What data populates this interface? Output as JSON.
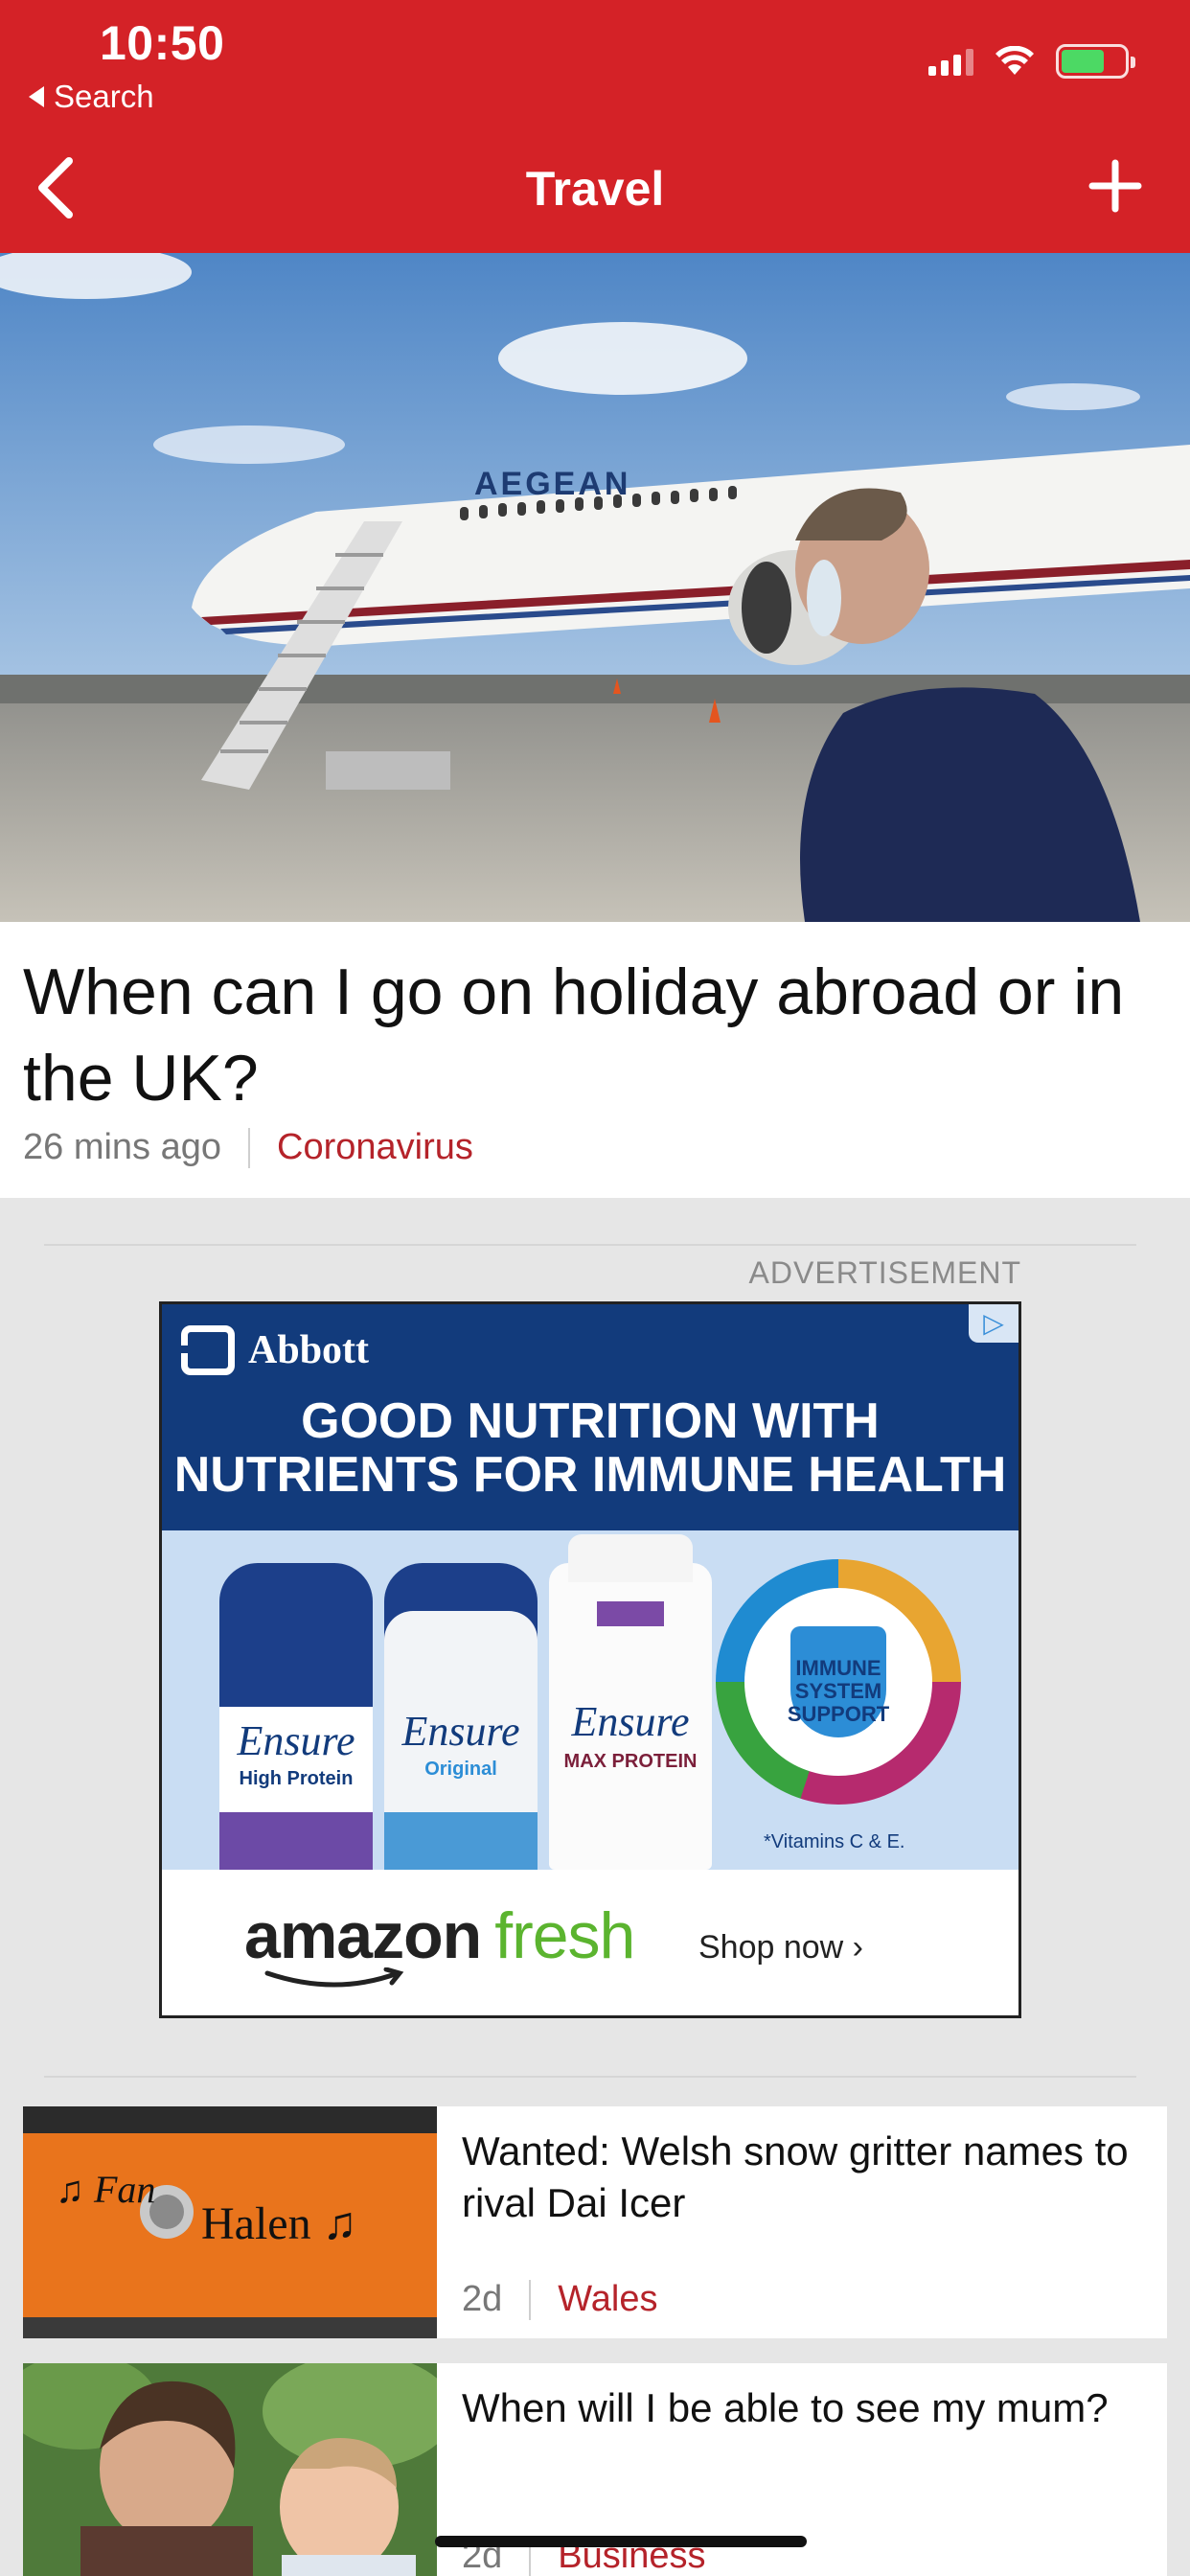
{
  "status_bar": {
    "time": "10:50",
    "back_app": "Search"
  },
  "nav": {
    "title": "Travel"
  },
  "lead_story": {
    "headline": "When can I go on holiday abroad or in the UK?",
    "time": "26 mins ago",
    "category": "Coronavirus",
    "image_caption_text": "AEGEAN"
  },
  "advertisement": {
    "label": "ADVERTISEMENT",
    "brand": "Abbott",
    "headline_line1": "GOOD NUTRITION WITH",
    "headline_line2": "NUTRIENTS FOR IMMUNE HEALTH",
    "products": [
      {
        "name": "Ensure",
        "subtitle": "High Protein"
      },
      {
        "name": "Ensure",
        "subtitle": "Original"
      },
      {
        "name": "Ensure",
        "subtitle": "MAX PROTEIN"
      }
    ],
    "badge_text": "IMMUNE SYSTEM SUPPORT",
    "vitamins_note": "*Vitamins C & E.",
    "retailer_part1": "amazon",
    "retailer_part2": "fresh",
    "cta": "Shop now ›"
  },
  "stories": [
    {
      "headline": "Wanted: Welsh snow gritter names to rival Dai Icer",
      "time": "2d",
      "category": "Wales",
      "thumb_text": "Fan Halen"
    },
    {
      "headline": "When will I be able to see my mum?",
      "time": "2d",
      "category": "Business"
    }
  ],
  "colors": {
    "brand_red": "#d42227",
    "category_red": "#b5232a",
    "ad_navy": "#123b7c",
    "battery_green": "#4cd964"
  }
}
